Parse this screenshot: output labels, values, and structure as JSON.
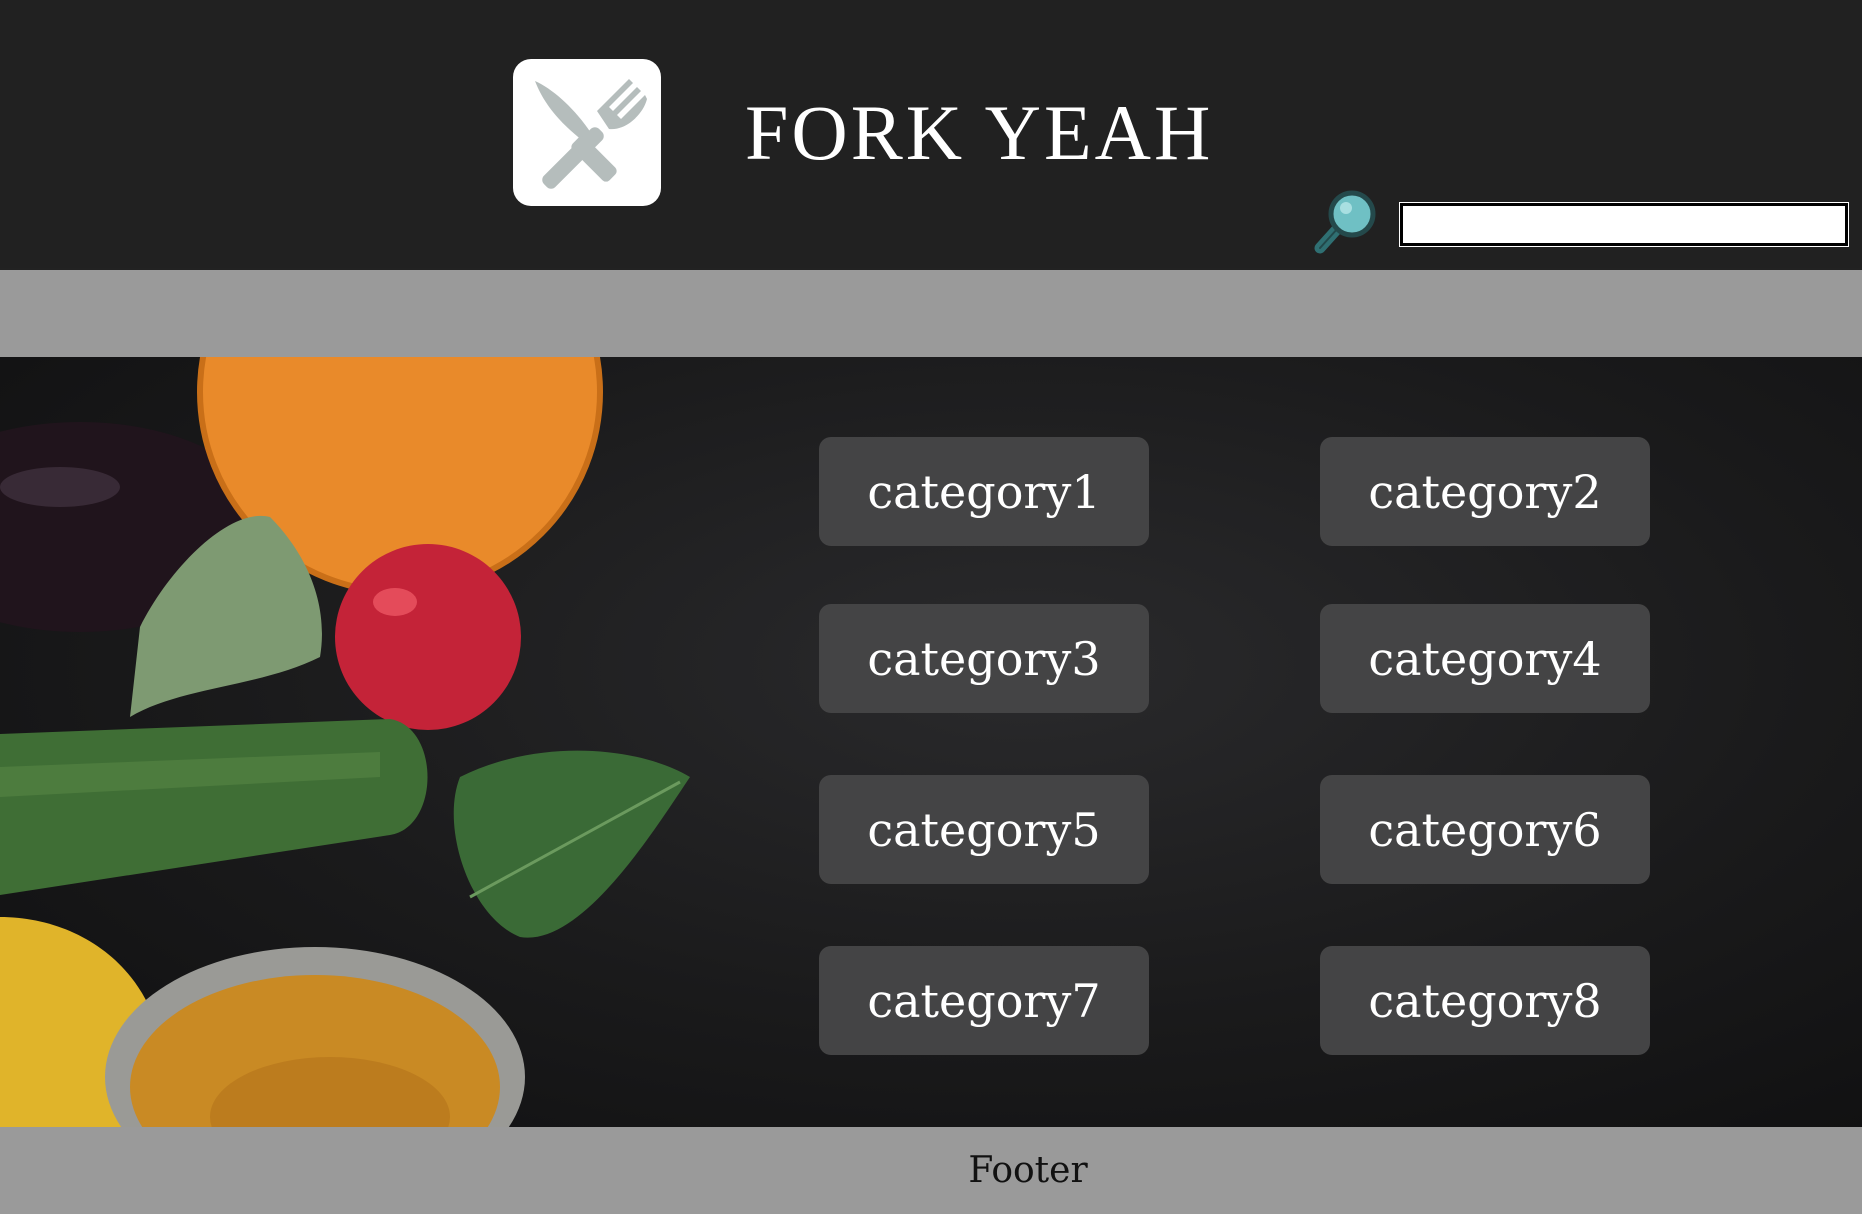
{
  "header": {
    "logo_icon": "fork-knife-icon",
    "title": "FORK YEAH",
    "search": {
      "icon": "magnifier-icon",
      "value": "",
      "placeholder": ""
    }
  },
  "categories": [
    {
      "label": "category1"
    },
    {
      "label": "category2"
    },
    {
      "label": "category3"
    },
    {
      "label": "category4"
    },
    {
      "label": "category5"
    },
    {
      "label": "category6"
    },
    {
      "label": "category7"
    },
    {
      "label": "category8"
    }
  ],
  "footer": {
    "text": "Footer"
  },
  "colors": {
    "header_bg": "#212121",
    "bar_bg": "#9a9a9a",
    "button_bg": "#444445",
    "button_text": "#ffffff",
    "logo_icon": "#b5bdbc",
    "search_icon": "#6fc0c4"
  }
}
